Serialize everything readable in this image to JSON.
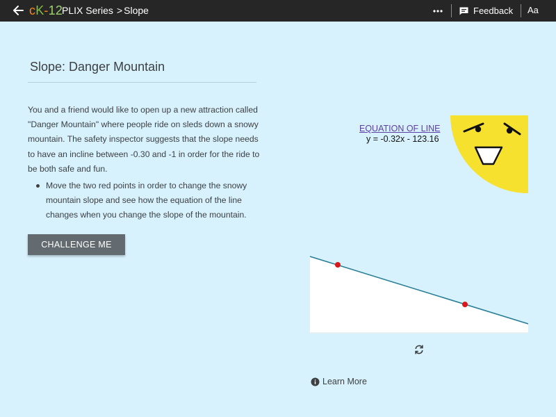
{
  "topbar": {
    "logo": {
      "c": "c",
      "k": "K",
      "dash": "-",
      "num": "12"
    },
    "series": "PLIX Series",
    "separator": ">",
    "page": "Slope",
    "feedback_label": "Feedback",
    "text_size_label": "Aa"
  },
  "main": {
    "title": "Slope: Danger Mountain",
    "description": "You and a friend would like to open up a new attraction called \"Danger Mountain\" where people ride on sleds down a snowy mountain. The safety inspector suggests that the slope needs to have an incline between -0.30 and -1 in order for the ride to be both safe and fun.",
    "instructions": [
      "Move the two red points in order to change the snowy mountain slope and see how the equation of the line changes when you change the slope of the mountain."
    ],
    "challenge_label": "CHALLENGE ME"
  },
  "interactive": {
    "equation_heading": "EQUATION OF LINE",
    "equation": "y = -0.32x - 123.16",
    "learn_more_label": "Learn More"
  },
  "colors": {
    "background": "#d8f2fd",
    "topbar": "#262626",
    "sun": "#f7e12f",
    "line": "#2a7f96",
    "point": "#d8181d",
    "button": "#636b70"
  },
  "icons": {
    "back": "back-arrow-icon",
    "more": "more-horizontal-icon",
    "feedback": "feedback-icon",
    "reset": "refresh-icon",
    "info": "info-icon"
  }
}
